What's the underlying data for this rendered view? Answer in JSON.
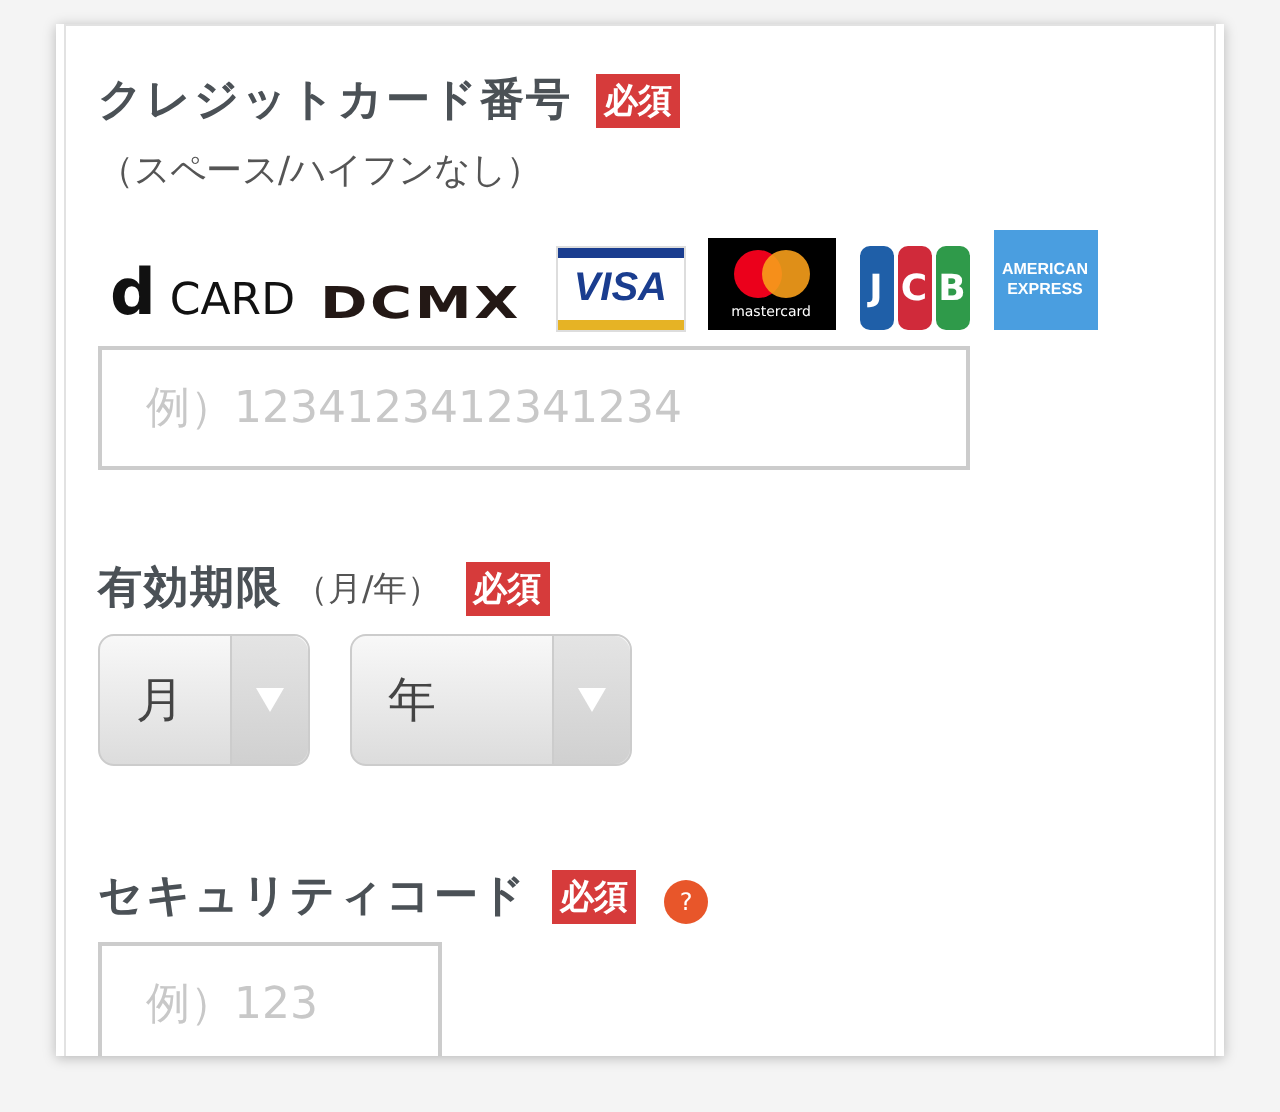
{
  "card_number": {
    "label": "クレジットカード番号",
    "required": "必須",
    "note": "（スペース/ハイフンなし）",
    "brands": [
      {
        "kind": "dcard",
        "text": "**d** CARD"
      },
      {
        "kind": "dcmx",
        "text": "DCMX"
      },
      {
        "kind": "visa",
        "text": "VISA"
      },
      {
        "kind": "mastercard",
        "text": "mastercard"
      },
      {
        "kind": "jcb",
        "letters": [
          "J",
          "C",
          "B"
        ]
      },
      {
        "kind": "amex",
        "lines": [
          "AMERICAN",
          "EXPRESS"
        ]
      }
    ],
    "input": {
      "placeholder": "例）1234123412341234"
    }
  },
  "expiry": {
    "label": "有効期限",
    "hint": "（月/年）",
    "required": "必須",
    "selects": [
      {
        "value": "月"
      },
      {
        "value": "年"
      }
    ]
  },
  "security_code": {
    "label": "セキュリティコード",
    "required": "必須",
    "help": "?",
    "input": {
      "placeholder": "例）123"
    }
  }
}
